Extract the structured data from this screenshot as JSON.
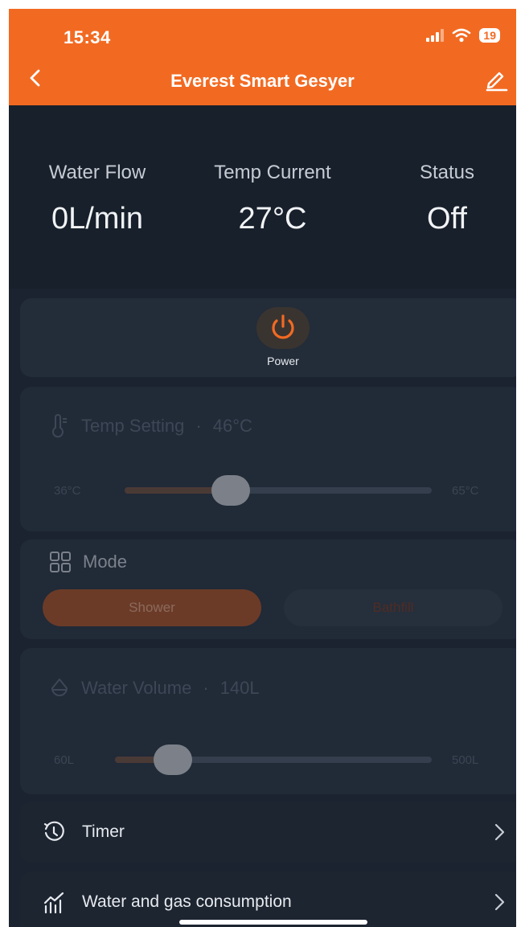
{
  "status_bar": {
    "time": "15:34",
    "battery": "19"
  },
  "header": {
    "title": "Everest Smart Gesyer"
  },
  "stats": [
    {
      "label": "Water Flow",
      "value": "0L/min"
    },
    {
      "label": "Temp Current",
      "value": "27°C"
    },
    {
      "label": "Status",
      "value": "Off"
    }
  ],
  "power": {
    "label": "Power"
  },
  "temp_setting": {
    "title": "Temp Setting",
    "separator": "·",
    "value": "46°C",
    "min_label": "36°C",
    "max_label": "65°C",
    "min": 36,
    "max": 65,
    "current": 46
  },
  "mode": {
    "title": "Mode",
    "options": [
      "Shower",
      "Bathfill"
    ],
    "selected": "Shower"
  },
  "water_volume": {
    "title": "Water Volume",
    "separator": "·",
    "value": "140L",
    "min_label": "60L",
    "max_label": "500L",
    "min": 60,
    "max": 500,
    "current": 140
  },
  "menu": [
    {
      "label": "Timer",
      "icon": "clock-icon"
    },
    {
      "label": "Water and gas consumption",
      "icon": "chart-icon"
    }
  ],
  "colors": {
    "accent": "#f26a22",
    "background": "#1b2330"
  }
}
